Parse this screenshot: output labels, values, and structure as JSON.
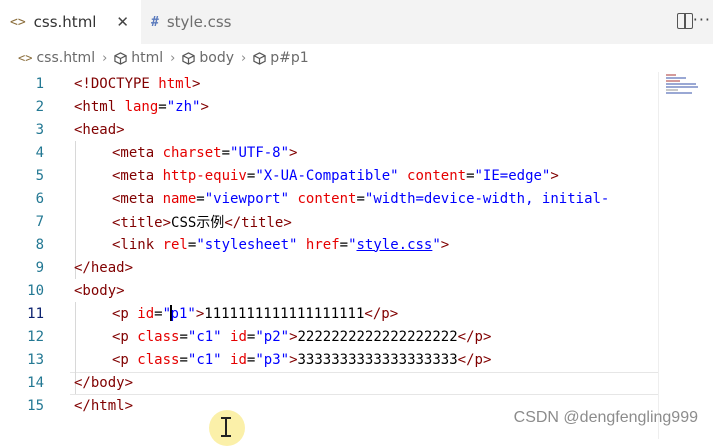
{
  "tabs": [
    {
      "icon": "<>",
      "label": "css.html",
      "close": "✕",
      "active": true
    },
    {
      "icon": "#",
      "label": "style.css",
      "active": false
    }
  ],
  "toolbar": {
    "more": "···"
  },
  "breadcrumb": {
    "file": "css.html",
    "items": [
      "html",
      "body",
      "p#p1"
    ]
  },
  "editor": {
    "line_numbers": [
      "1",
      "2",
      "3",
      "4",
      "5",
      "6",
      "7",
      "8",
      "9",
      "10",
      "11",
      "12",
      "13",
      "14",
      "15"
    ],
    "current_line": "11"
  },
  "watermark": "CSDN @dengfengling999",
  "colors": {
    "tag": "#800000",
    "attribute": "#e50000",
    "value": "#0000ff",
    "line_number": "#237893"
  }
}
